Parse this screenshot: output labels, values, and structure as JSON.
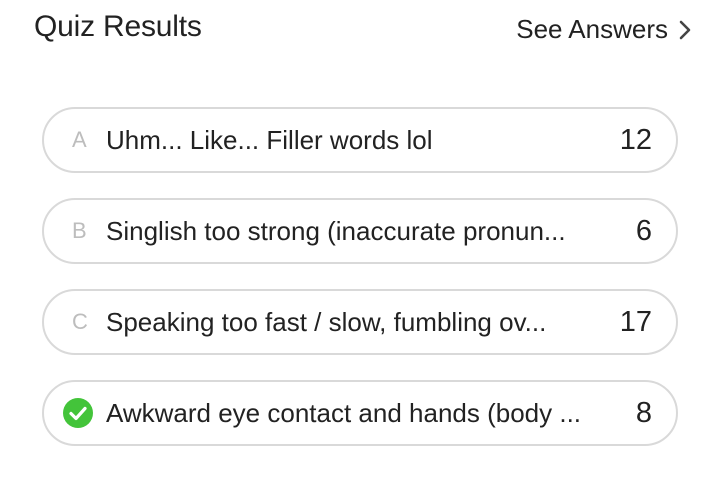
{
  "header": {
    "title": "Quiz Results",
    "see_answers_label": "See Answers"
  },
  "options": [
    {
      "letter": "A",
      "text": "Uhm... Like... Filler words lol",
      "count": "12",
      "correct": false
    },
    {
      "letter": "B",
      "text": "Singlish too strong (inaccurate pronun...",
      "count": "6",
      "correct": false
    },
    {
      "letter": "C",
      "text": "Speaking too fast / slow, fumbling ov...",
      "count": "17",
      "correct": false
    },
    {
      "letter": "",
      "text": "Awkward eye contact and hands (body ...",
      "count": "8",
      "correct": true
    }
  ],
  "icons": {
    "chevron": "chevron-right-icon",
    "check": "check-circle-icon"
  },
  "colors": {
    "check_green": "#43c43a",
    "border": "#d9d9d9",
    "letter_gray": "#bdbdbd",
    "text": "#222222"
  }
}
